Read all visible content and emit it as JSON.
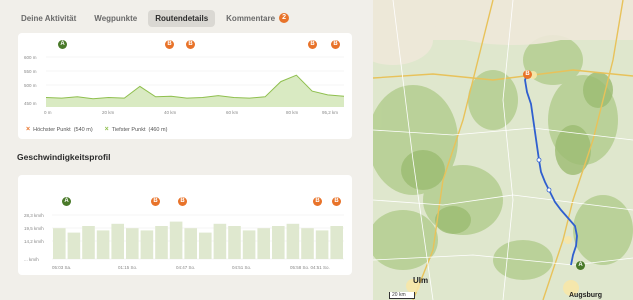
{
  "tabs": [
    {
      "label": "Deine Aktivität"
    },
    {
      "label": "Wegpunkte"
    },
    {
      "label": "Routendetails"
    },
    {
      "label": "Kommentare",
      "count": "2"
    }
  ],
  "elevation": {
    "y_ticks": [
      "600 m",
      "550 m",
      "500 m",
      "450 m"
    ],
    "x_ticks": [
      "0 m",
      "20 km",
      "40 km",
      "60 km",
      "80 km",
      "95,2 km"
    ],
    "waypoints": [
      "A",
      "B",
      "B",
      "B",
      "B"
    ],
    "legend": {
      "highest_label": "Höchster Punkt",
      "highest_value": "(540 m)",
      "lowest_label": "Tiefster Punkt",
      "lowest_value": "(460 m)"
    },
    "colors": {
      "line": "#8fbf4e",
      "fill": "#d9eac2",
      "highest": "#e8732a",
      "lowest": "#8fbf4e"
    }
  },
  "speed": {
    "title": "Geschwindigkeitsprofil",
    "y_ticks": [
      "28,3 km/h",
      "19,5 km/h",
      "14,2 km/h",
      "... km/h"
    ],
    "x_ticks": [
      "05:03 Sa.",
      "01:15 So.",
      "04:47 So.",
      "04:51 So.",
      "05:58 So. 04:51 So."
    ],
    "waypoints": [
      "A",
      "B",
      "B",
      "B",
      "B"
    ]
  },
  "map": {
    "cities": [
      {
        "name": "Ulm"
      },
      {
        "name": "Augsburg"
      }
    ],
    "scale": "20 km",
    "markers": {
      "start": "A",
      "end": "B"
    },
    "route_color": "#2f5fcf"
  },
  "chart_data": [
    {
      "type": "area",
      "title": "",
      "xlabel": "",
      "ylabel": "",
      "x": [
        0,
        5,
        10,
        15,
        20,
        25,
        30,
        35,
        40,
        45,
        50,
        55,
        60,
        65,
        70,
        75,
        80,
        85,
        90,
        95.2
      ],
      "y": [
        470,
        468,
        472,
        466,
        470,
        468,
        505,
        472,
        474,
        468,
        470,
        476,
        470,
        468,
        472,
        520,
        540,
        490,
        478,
        474
      ],
      "xlim": [
        0,
        95.2
      ],
      "ylim": [
        440,
        610
      ]
    },
    {
      "type": "area",
      "title": "",
      "xlabel": "",
      "ylabel": "",
      "x": [
        0,
        5,
        10,
        15,
        20,
        25,
        30,
        35,
        40,
        45,
        50,
        55,
        60,
        65,
        70,
        75,
        80,
        85,
        90,
        95
      ],
      "y": [
        14,
        12,
        15,
        13,
        16,
        14,
        13,
        15,
        17,
        14,
        12,
        16,
        15,
        13,
        14,
        15,
        16,
        14,
        13,
        15
      ]
    }
  ]
}
